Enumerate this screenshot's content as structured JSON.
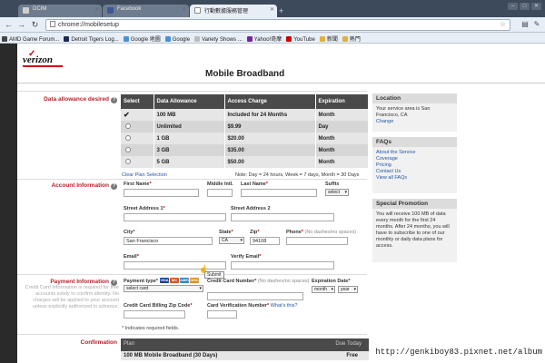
{
  "browser": {
    "tabs": [
      {
        "label": "DCIM",
        "active": false,
        "icon_color": "#cfcfcf"
      },
      {
        "label": "Facebook",
        "active": false,
        "icon_color": "#3b5998"
      },
      {
        "label": "行動數據服務管理",
        "active": true,
        "icon_color": "#ffffff"
      }
    ],
    "new_tab": "+",
    "url": "chrome://mobilesetup",
    "bookmarks": [
      {
        "label": "AMD Game Forum...",
        "icon_color": "#444444"
      },
      {
        "label": "Detroit Tigers Log...",
        "icon_color": "#1a2a55"
      },
      {
        "label": "Google 地圖",
        "icon_color": "#4a8fd8"
      },
      {
        "label": "Google",
        "icon_color": "#4a8fd8"
      },
      {
        "label": "Variety Shows ...",
        "icon_color": "#bbbbbb"
      },
      {
        "label": "Yahoo!奇摩",
        "icon_color": "#7b1fa2"
      },
      {
        "label": "YouTube",
        "icon_color": "#cc0000"
      },
      {
        "label": "新聞",
        "icon_color": "#e0b040"
      },
      {
        "label": "熱門",
        "icon_color": "#e0b040"
      }
    ]
  },
  "header": {
    "logo": "verizon",
    "title": "Mobile Broadband"
  },
  "sections": {
    "data_allowance": "Data allowance desired",
    "account_info": "Account Information",
    "payment_info": "Payment Information",
    "payment_help": "Credit Card Information is required for free accounts solely to confirm identity. No charges will be applied to your account unless explicitly authorized in advance.",
    "confirmation": "Confirmation"
  },
  "plans": {
    "headers": [
      "Select",
      "Data Allowance",
      "Access Charge",
      "Expiration"
    ],
    "rows": [
      {
        "allowance": "100 MB",
        "charge": "Included for 24 Months",
        "expiration": "Month",
        "selected": true
      },
      {
        "allowance": "Unlimited",
        "charge": "$9.99",
        "expiration": "Day",
        "selected": false
      },
      {
        "allowance": "1 GB",
        "charge": "$20.00",
        "expiration": "Month",
        "selected": false
      },
      {
        "allowance": "3 GB",
        "charge": "$35.00",
        "expiration": "Month",
        "selected": false
      },
      {
        "allowance": "5 GB",
        "charge": "$50.00",
        "expiration": "Month",
        "selected": false
      }
    ],
    "clear_label": "Clear Plan Selection",
    "note": "Note: Day = 24 hours, Week = 7 days, Month = 30 Days"
  },
  "form": {
    "first_name": "First Name",
    "middle_initial": "Middle Intl.",
    "last_name": "Last Name",
    "suffix": "Suffix",
    "suffix_value": "select",
    "street1": "Street Address 1",
    "street2": "Street Address 2",
    "city": "City",
    "city_value": "San Francisco",
    "state": "State",
    "state_value": "CA",
    "zip": "Zip",
    "zip_value": "94108",
    "phone": "Phone",
    "phone_hint": "(No dashes/no spaces)",
    "email": "Email",
    "verify_email": "Verify Email",
    "payment_type": "Payment type",
    "payment_value": "select card",
    "card_number": "Credit Card Number",
    "card_hint": "(No dashes/no spaces)",
    "expiration": "Expiration Date",
    "exp_month": "month",
    "exp_year": "year",
    "billing_zip": "Credit Card Billing Zip Code",
    "cvv": "Card Verification Number",
    "cvv_link": "What's this?",
    "required_note": "* Indicates required fields.",
    "tooltip": "Submit",
    "card_brands": [
      {
        "label": "VISA",
        "color": "#1a3d8f"
      },
      {
        "label": "MC",
        "color": "#d9531e"
      },
      {
        "label": "AMEX",
        "color": "#2f7fc1"
      },
      {
        "label": "DISC",
        "color": "#e08a1e"
      }
    ]
  },
  "confirmation": {
    "col_plan": "Plan",
    "col_due": "Due Today",
    "row_plan": "100 MB Mobile Broadband (30 Days)",
    "row_due": "Free"
  },
  "sidebar": {
    "location_title": "Location",
    "location_text": "Your service area is San Francisco, CA",
    "location_link": "Change",
    "faq_title": "FAQs",
    "faq_links": [
      "About the Service",
      "Coverage",
      "Pricing",
      "Contact Us",
      "View all FAQs"
    ],
    "promo_title": "Special Promotion",
    "promo_text": "You will receive 100 MB of data every month for the first 24 months. After 24 months, you will have to subscribe to one of our monthly or daily data plans for access."
  },
  "watermark": "http://genkiboy83.pixnet.net/album"
}
